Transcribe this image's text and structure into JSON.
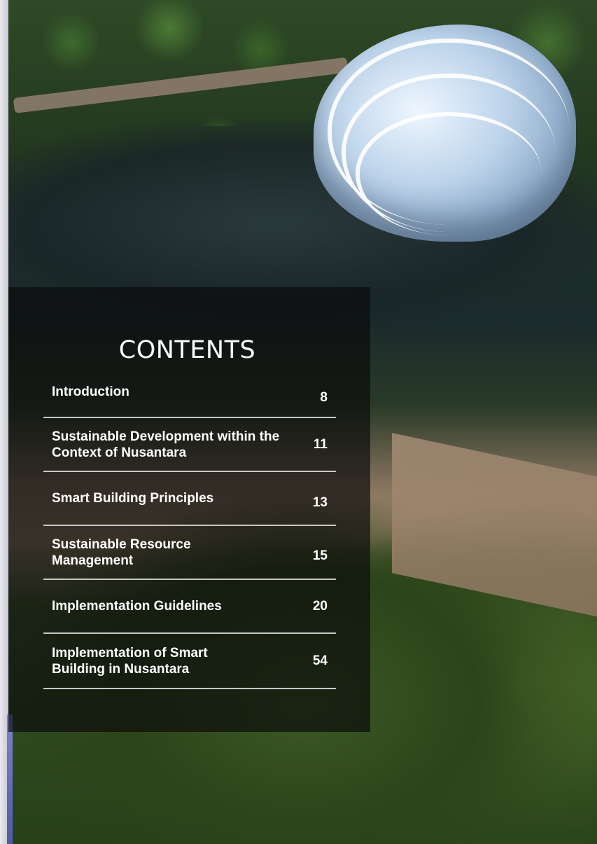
{
  "heading": "CONTENTS",
  "toc": [
    {
      "label": "Introduction",
      "page": "8"
    },
    {
      "label": "Sustainable Development within the Context of Nusantara",
      "page": "11"
    },
    {
      "label": "Smart Building Principles",
      "page": "13"
    },
    {
      "label": "Sustainable Resource Management",
      "page": "15"
    },
    {
      "label": "Implementation Guidelines",
      "page": "20"
    },
    {
      "label": "Implementation of Smart Building in Nusantara",
      "page": "54"
    }
  ]
}
